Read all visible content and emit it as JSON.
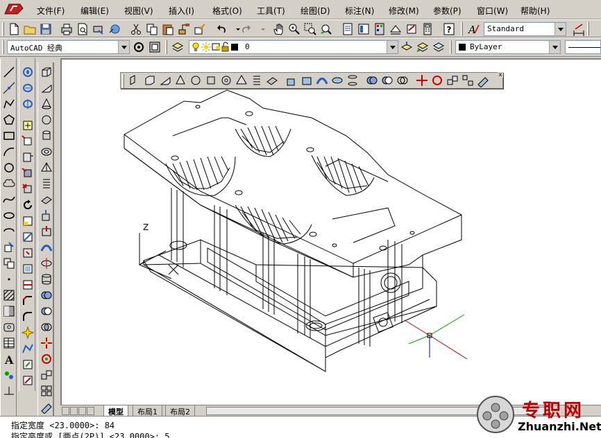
{
  "menu": {
    "items": [
      {
        "label": "文件(F)"
      },
      {
        "label": "编辑(E)"
      },
      {
        "label": "视图(V)"
      },
      {
        "label": "插入(I)"
      },
      {
        "label": "格式(O)"
      },
      {
        "label": "工具(T)"
      },
      {
        "label": "绘图(D)"
      },
      {
        "label": "标注(N)"
      },
      {
        "label": "修改(M)"
      },
      {
        "label": "参数(P)"
      },
      {
        "label": "窗口(W)"
      },
      {
        "label": "帮助(H)"
      }
    ]
  },
  "toolbar": {
    "text_style": "Standard"
  },
  "workspace": {
    "value": "AutoCAD 经典"
  },
  "layer": {
    "value": "0",
    "color_swatch": "#000000"
  },
  "properties": {
    "color": "ByLayer",
    "color_swatch": "#000000"
  },
  "layout_tabs": {
    "items": [
      {
        "label": "模型"
      },
      {
        "label": "布局1"
      },
      {
        "label": "布局2"
      }
    ],
    "active": "模型"
  },
  "ucs": {
    "z_label": "Z"
  },
  "command": {
    "lines": [
      "指定宽度 <23.0000>: 84",
      "指定高度或 [两点(2P)] <23.0000>: 5"
    ]
  },
  "watermark": {
    "title": "专职网",
    "url": "Zhuanzhi.Net"
  },
  "colors": {
    "ui_face": "#d4d0c8",
    "canvas": "#ffffff",
    "watermark_red": "#c00000"
  }
}
